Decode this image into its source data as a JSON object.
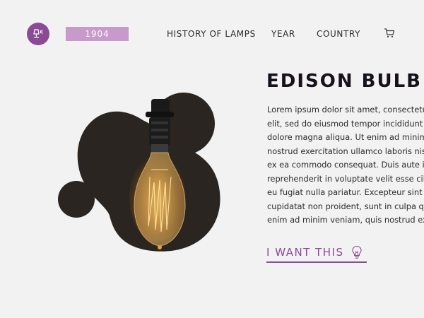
{
  "header": {
    "logo_icon": "lamp-icon",
    "year": "1904",
    "nav": [
      "HISTORY OF LAMPS",
      "YEAR",
      "COUNTRY"
    ],
    "cart_icon": "cart-icon"
  },
  "product": {
    "title": "EDISON BULB",
    "description_lines": [
      "Lorem ipsum dolor sit amet, consectetur",
      "elit, sed do eiusmod tempor incididunt",
      "dolore magna aliqua. Ut enim ad minim",
      "nostrud exercitation ullamco laboris nisi",
      "ex ea commodo consequat. Duis aute ir",
      "reprehenderit in voluptate velit esse cill",
      "eu fugiat nulla pariatur. Excepteur sint o",
      "cupidatat non proident, sunt in culpa qu",
      "enim ad minim veniam, quis nostrud exe"
    ],
    "cta_label": "I WANT THIS",
    "cta_icon": "lightbulb-icon"
  },
  "colors": {
    "accent": "#8a4a96",
    "year_pill": "#c79acb",
    "background": "#f3f2f2",
    "bubble": "#2a2520"
  }
}
